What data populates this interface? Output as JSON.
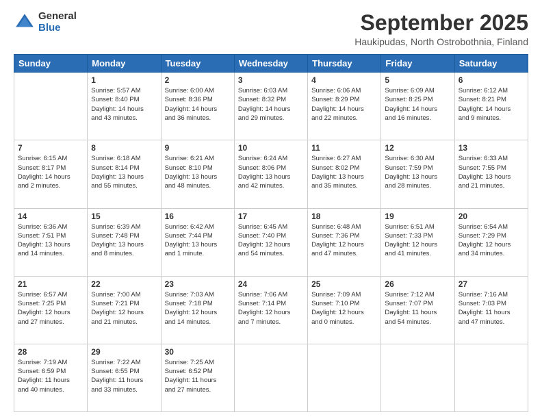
{
  "logo": {
    "general": "General",
    "blue": "Blue"
  },
  "title": "September 2025",
  "subtitle": "Haukipudas, North Ostrobothnia, Finland",
  "headers": [
    "Sunday",
    "Monday",
    "Tuesday",
    "Wednesday",
    "Thursday",
    "Friday",
    "Saturday"
  ],
  "weeks": [
    [
      {
        "day": "",
        "info": ""
      },
      {
        "day": "1",
        "info": "Sunrise: 5:57 AM\nSunset: 8:40 PM\nDaylight: 14 hours\nand 43 minutes."
      },
      {
        "day": "2",
        "info": "Sunrise: 6:00 AM\nSunset: 8:36 PM\nDaylight: 14 hours\nand 36 minutes."
      },
      {
        "day": "3",
        "info": "Sunrise: 6:03 AM\nSunset: 8:32 PM\nDaylight: 14 hours\nand 29 minutes."
      },
      {
        "day": "4",
        "info": "Sunrise: 6:06 AM\nSunset: 8:29 PM\nDaylight: 14 hours\nand 22 minutes."
      },
      {
        "day": "5",
        "info": "Sunrise: 6:09 AM\nSunset: 8:25 PM\nDaylight: 14 hours\nand 16 minutes."
      },
      {
        "day": "6",
        "info": "Sunrise: 6:12 AM\nSunset: 8:21 PM\nDaylight: 14 hours\nand 9 minutes."
      }
    ],
    [
      {
        "day": "7",
        "info": "Sunrise: 6:15 AM\nSunset: 8:17 PM\nDaylight: 14 hours\nand 2 minutes."
      },
      {
        "day": "8",
        "info": "Sunrise: 6:18 AM\nSunset: 8:14 PM\nDaylight: 13 hours\nand 55 minutes."
      },
      {
        "day": "9",
        "info": "Sunrise: 6:21 AM\nSunset: 8:10 PM\nDaylight: 13 hours\nand 48 minutes."
      },
      {
        "day": "10",
        "info": "Sunrise: 6:24 AM\nSunset: 8:06 PM\nDaylight: 13 hours\nand 42 minutes."
      },
      {
        "day": "11",
        "info": "Sunrise: 6:27 AM\nSunset: 8:02 PM\nDaylight: 13 hours\nand 35 minutes."
      },
      {
        "day": "12",
        "info": "Sunrise: 6:30 AM\nSunset: 7:59 PM\nDaylight: 13 hours\nand 28 minutes."
      },
      {
        "day": "13",
        "info": "Sunrise: 6:33 AM\nSunset: 7:55 PM\nDaylight: 13 hours\nand 21 minutes."
      }
    ],
    [
      {
        "day": "14",
        "info": "Sunrise: 6:36 AM\nSunset: 7:51 PM\nDaylight: 13 hours\nand 14 minutes."
      },
      {
        "day": "15",
        "info": "Sunrise: 6:39 AM\nSunset: 7:48 PM\nDaylight: 13 hours\nand 8 minutes."
      },
      {
        "day": "16",
        "info": "Sunrise: 6:42 AM\nSunset: 7:44 PM\nDaylight: 13 hours\nand 1 minute."
      },
      {
        "day": "17",
        "info": "Sunrise: 6:45 AM\nSunset: 7:40 PM\nDaylight: 12 hours\nand 54 minutes."
      },
      {
        "day": "18",
        "info": "Sunrise: 6:48 AM\nSunset: 7:36 PM\nDaylight: 12 hours\nand 47 minutes."
      },
      {
        "day": "19",
        "info": "Sunrise: 6:51 AM\nSunset: 7:33 PM\nDaylight: 12 hours\nand 41 minutes."
      },
      {
        "day": "20",
        "info": "Sunrise: 6:54 AM\nSunset: 7:29 PM\nDaylight: 12 hours\nand 34 minutes."
      }
    ],
    [
      {
        "day": "21",
        "info": "Sunrise: 6:57 AM\nSunset: 7:25 PM\nDaylight: 12 hours\nand 27 minutes."
      },
      {
        "day": "22",
        "info": "Sunrise: 7:00 AM\nSunset: 7:21 PM\nDaylight: 12 hours\nand 21 minutes."
      },
      {
        "day": "23",
        "info": "Sunrise: 7:03 AM\nSunset: 7:18 PM\nDaylight: 12 hours\nand 14 minutes."
      },
      {
        "day": "24",
        "info": "Sunrise: 7:06 AM\nSunset: 7:14 PM\nDaylight: 12 hours\nand 7 minutes."
      },
      {
        "day": "25",
        "info": "Sunrise: 7:09 AM\nSunset: 7:10 PM\nDaylight: 12 hours\nand 0 minutes."
      },
      {
        "day": "26",
        "info": "Sunrise: 7:12 AM\nSunset: 7:07 PM\nDaylight: 11 hours\nand 54 minutes."
      },
      {
        "day": "27",
        "info": "Sunrise: 7:16 AM\nSunset: 7:03 PM\nDaylight: 11 hours\nand 47 minutes."
      }
    ],
    [
      {
        "day": "28",
        "info": "Sunrise: 7:19 AM\nSunset: 6:59 PM\nDaylight: 11 hours\nand 40 minutes."
      },
      {
        "day": "29",
        "info": "Sunrise: 7:22 AM\nSunset: 6:55 PM\nDaylight: 11 hours\nand 33 minutes."
      },
      {
        "day": "30",
        "info": "Sunrise: 7:25 AM\nSunset: 6:52 PM\nDaylight: 11 hours\nand 27 minutes."
      },
      {
        "day": "",
        "info": ""
      },
      {
        "day": "",
        "info": ""
      },
      {
        "day": "",
        "info": ""
      },
      {
        "day": "",
        "info": ""
      }
    ]
  ]
}
